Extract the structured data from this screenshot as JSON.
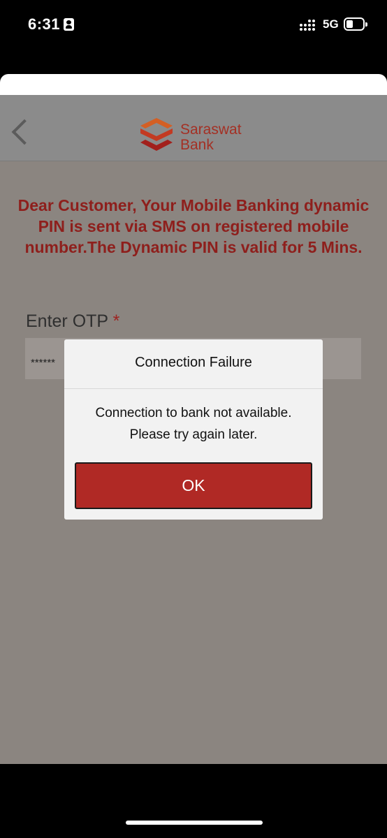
{
  "status_bar": {
    "time": "6:31",
    "network": "5G",
    "icons": [
      "id-card-icon",
      "signal-dots-icon",
      "battery-icon"
    ]
  },
  "header": {
    "back_icon": "chevron-left-icon",
    "logo_line1": "Saraswat",
    "logo_line2": "Bank"
  },
  "main": {
    "notice": "Dear Customer, Your Mobile Banking dynamic PIN is sent via SMS on registered mobile number.The Dynamic PIN is valid for 5 Mins.",
    "otp_label": "Enter OTP",
    "required_marker": "*",
    "otp_value": "******"
  },
  "dialog": {
    "title": "Connection Failure",
    "message_line1": "Connection to bank not available.",
    "message_line2": "Please try again later.",
    "ok_label": "OK"
  },
  "colors": {
    "brand_red": "#a43024",
    "notice_red": "#8e1f1c",
    "ok_button": "#b02925",
    "overlay_gray": "#8b8580"
  }
}
